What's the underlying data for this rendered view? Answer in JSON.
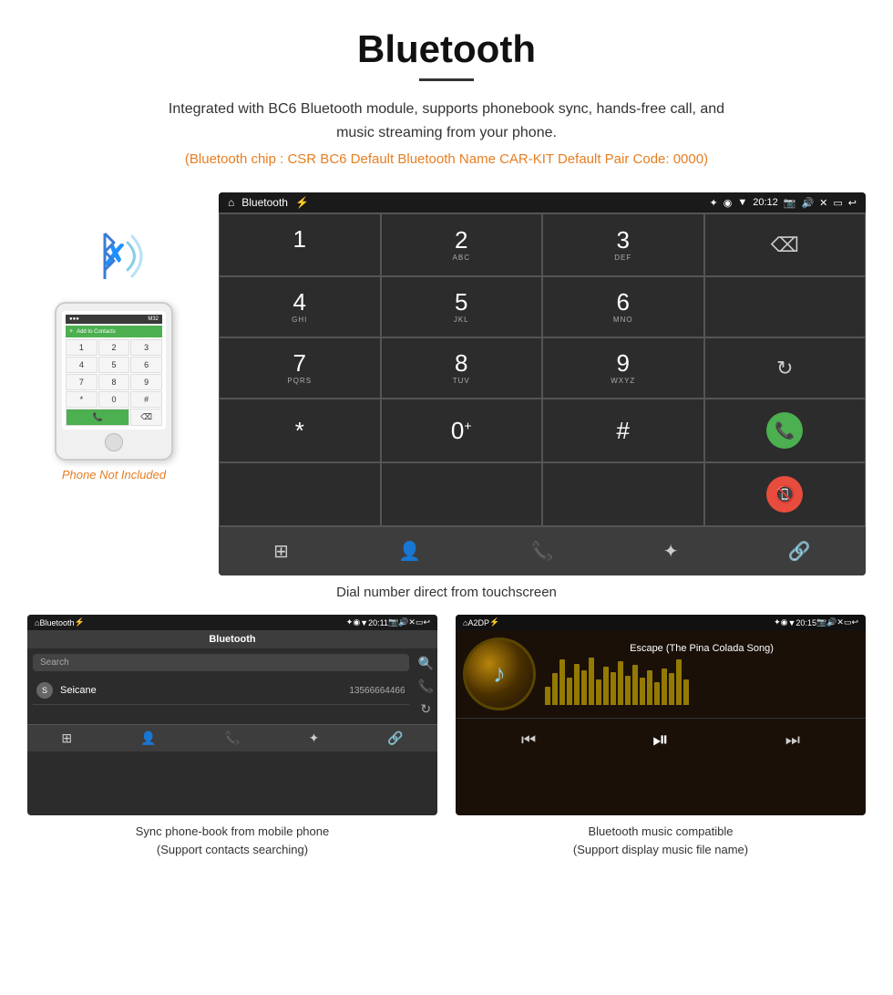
{
  "page": {
    "title": "Bluetooth",
    "subtitle": "Integrated with BC6 Bluetooth module, supports phonebook sync, hands-free call, and music streaming from your phone.",
    "info_line": "(Bluetooth chip : CSR BC6    Default Bluetooth Name CAR-KIT    Default Pair Code: 0000)",
    "dial_caption": "Dial number direct from touchscreen",
    "phonebook_caption": "Sync phone-book from mobile phone\n(Support contacts searching)",
    "music_caption": "Bluetooth music compatible\n(Support display music file name)"
  },
  "phone_illustration": {
    "not_included": "Phone Not Included"
  },
  "dial_screen": {
    "app_name": "Bluetooth",
    "status_time": "20:12",
    "keys": [
      {
        "main": "1",
        "sub": ""
      },
      {
        "main": "2",
        "sub": "ABC"
      },
      {
        "main": "3",
        "sub": "DEF"
      },
      {
        "main": "DELETE",
        "sub": ""
      },
      {
        "main": "4",
        "sub": "GHI"
      },
      {
        "main": "5",
        "sub": "JKL"
      },
      {
        "main": "6",
        "sub": "MNO"
      },
      {
        "main": "EMPTY",
        "sub": ""
      },
      {
        "main": "7",
        "sub": "PQRS"
      },
      {
        "main": "8",
        "sub": "TUV"
      },
      {
        "main": "9",
        "sub": "WXYZ"
      },
      {
        "main": "REFRESH",
        "sub": ""
      },
      {
        "main": "*",
        "sub": ""
      },
      {
        "main": "0",
        "sub": "+"
      },
      {
        "main": "#",
        "sub": ""
      },
      {
        "main": "GREEN_CALL",
        "sub": ""
      },
      {
        "main": "RED_CALL",
        "sub": ""
      }
    ]
  },
  "phonebook_screen": {
    "app_name": "Bluetooth",
    "status_time": "20:11",
    "search_placeholder": "Search",
    "contacts": [
      {
        "letter": "S",
        "name": "Seicane",
        "number": "13566664466"
      }
    ]
  },
  "music_screen": {
    "app_name": "A2DP",
    "status_time": "20:15",
    "song_title": "Escape (The Pina Colada Song)",
    "eq_bars": [
      20,
      35,
      50,
      30,
      45,
      38,
      52,
      28,
      42,
      36,
      48,
      32,
      44,
      30,
      38,
      25,
      40,
      35,
      50,
      28
    ]
  },
  "colors": {
    "accent_orange": "#e67e22",
    "android_bg": "#2c2c2c",
    "android_bar": "#3d3d3d",
    "green_call": "#4CAF50",
    "red_call": "#e74c3c"
  }
}
